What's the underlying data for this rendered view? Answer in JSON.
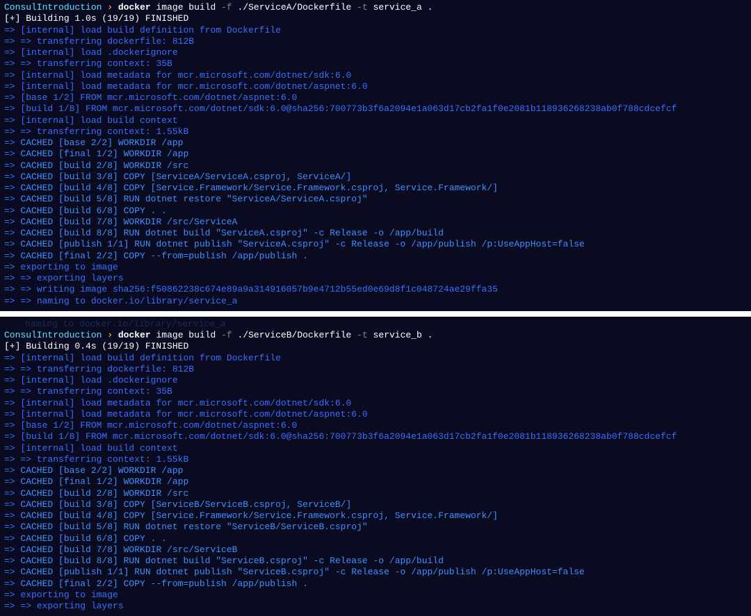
{
  "blocks": [
    {
      "prompt": {
        "path": "ConsulIntroduction",
        "sep": "›",
        "cmd_bold": "docker",
        "cmd_rest1": " image build ",
        "flag1": "-f",
        "arg1": " ./ServiceA/Dockerfile ",
        "flag2": "-t",
        "arg2": " service_a ."
      },
      "status": "[+] Building 1.0s (19/19) FINISHED",
      "lines": [
        "=> [internal] load build definition from Dockerfile",
        "=> => transferring dockerfile: 812B",
        "=> [internal] load .dockerignore",
        "=> => transferring context: 35B",
        "=> [internal] load metadata for mcr.microsoft.com/dotnet/sdk:6.0",
        "=> [internal] load metadata for mcr.microsoft.com/dotnet/aspnet:6.0",
        "=> [base 1/2] FROM mcr.microsoft.com/dotnet/aspnet:6.0",
        "=> [build 1/8] FROM mcr.microsoft.com/dotnet/sdk:6.0@sha256:700773b3f6a2094e1a063d17cb2fa1f0e2081b118936268238ab0f788cdcefcf",
        "=> [internal] load build context",
        "=> => transferring context: 1.55kB",
        "=> CACHED [base 2/2] WORKDIR /app",
        "=> CACHED [final 1/2] WORKDIR /app",
        "=> CACHED [build 2/8] WORKDIR /src",
        "=> CACHED [build 3/8] COPY [ServiceA/ServiceA.csproj, ServiceA/]",
        "=> CACHED [build 4/8] COPY [Service.Framework/Service.Framework.csproj, Service.Framework/]",
        "=> CACHED [build 5/8] RUN dotnet restore \"ServiceA/ServiceA.csproj\"",
        "=> CACHED [build 6/8] COPY . .",
        "=> CACHED [build 7/8] WORKDIR /src/ServiceA",
        "=> CACHED [build 8/8] RUN dotnet build \"ServiceA.csproj\" -c Release -o /app/build",
        "=> CACHED [publish 1/1] RUN dotnet publish \"ServiceA.csproj\" -c Release -o /app/publish /p:UseAppHost=false",
        "=> CACHED [final 2/2] COPY --from=publish /app/publish .",
        "=> exporting to image",
        "=> => exporting layers",
        "=> => writing image sha256:f50862238c674e89a9a314916057b9e4712b55ed0e69d8f1c048724ae29ffa35",
        "=> => naming to docker.io/library/service_a"
      ]
    },
    {
      "faded_top": "naming to docker.io/library/service_a",
      "prompt": {
        "path": "ConsulIntroduction",
        "sep": "›",
        "cmd_bold": "docker",
        "cmd_rest1": " image build ",
        "flag1": "-f",
        "arg1": " ./ServiceB/Dockerfile ",
        "flag2": "-t",
        "arg2": " service_b ."
      },
      "status": "[+] Building 0.4s (19/19) FINISHED",
      "lines": [
        "=> [internal] load build definition from Dockerfile",
        "=> => transferring dockerfile: 812B",
        "=> [internal] load .dockerignore",
        "=> => transferring context: 35B",
        "=> [internal] load metadata for mcr.microsoft.com/dotnet/sdk:6.0",
        "=> [internal] load metadata for mcr.microsoft.com/dotnet/aspnet:6.0",
        "=> [base 1/2] FROM mcr.microsoft.com/dotnet/aspnet:6.0",
        "=> [build 1/8] FROM mcr.microsoft.com/dotnet/sdk:6.0@sha256:700773b3f6a2094e1a063d17cb2fa1f0e2081b118936268238ab0f788cdcefcf",
        "=> [internal] load build context",
        "=> => transferring context: 1.55kB",
        "=> CACHED [base 2/2] WORKDIR /app",
        "=> CACHED [final 1/2] WORKDIR /app",
        "=> CACHED [build 2/8] WORKDIR /src",
        "=> CACHED [build 3/8] COPY [ServiceB/ServiceB.csproj, ServiceB/]",
        "=> CACHED [build 4/8] COPY [Service.Framework/Service.Framework.csproj, Service.Framework/]",
        "=> CACHED [build 5/8] RUN dotnet restore \"ServiceB/ServiceB.csproj\"",
        "=> CACHED [build 6/8] COPY . .",
        "=> CACHED [build 7/8] WORKDIR /src/ServiceB",
        "=> CACHED [build 8/8] RUN dotnet build \"ServiceB.csproj\" -c Release -o /app/build",
        "=> CACHED [publish 1/1] RUN dotnet publish \"ServiceB.csproj\" -c Release -o /app/publish /p:UseAppHost=false",
        "=> CACHED [final 2/2] COPY --from=publish /app/publish .",
        "=> exporting to image",
        "=> => exporting layers"
      ]
    }
  ]
}
